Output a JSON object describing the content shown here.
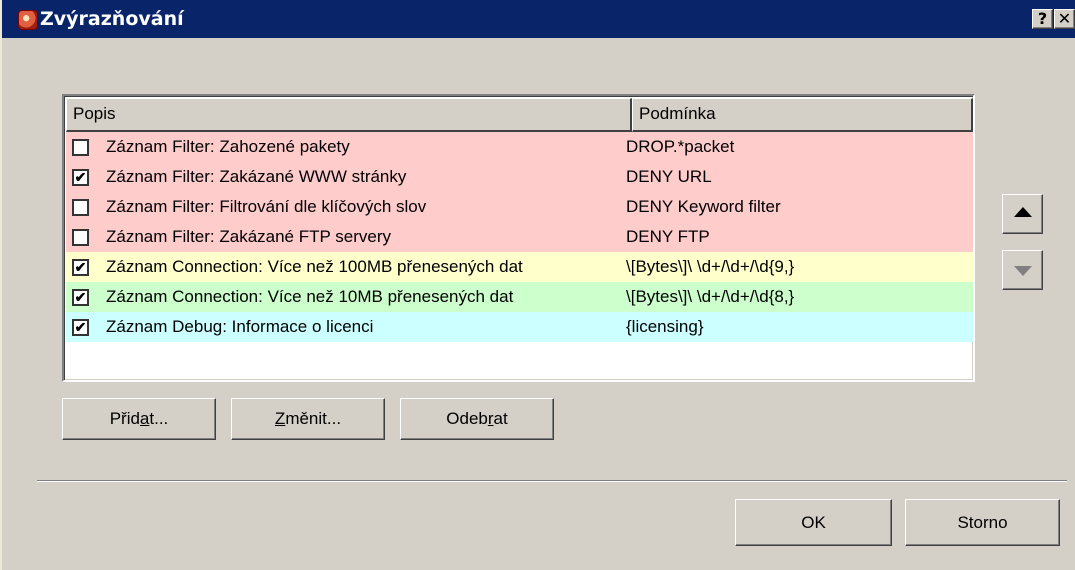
{
  "window": {
    "title": "Zvýrazňování",
    "help_label": "?",
    "close_label": "✕"
  },
  "list": {
    "columns": [
      "Popis",
      "Podmínka"
    ],
    "rows": [
      {
        "checked": "",
        "popis": "Záznam Filter: Zahozené pakety",
        "podminka": "DROP.*packet",
        "color": "#ffcccc"
      },
      {
        "checked": "✔",
        "popis": "Záznam Filter: Zakázané WWW stránky",
        "podminka": "DENY URL",
        "color": "#ffcccc"
      },
      {
        "checked": "",
        "popis": "Záznam Filter: Filtrování dle klíčových slov",
        "podminka": "DENY Keyword filter",
        "color": "#ffcccc"
      },
      {
        "checked": "",
        "popis": "Záznam Filter: Zakázané FTP servery",
        "podminka": "DENY FTP",
        "color": "#ffcccc"
      },
      {
        "checked": "✔",
        "popis": "Záznam Connection: Více než 100MB přenesených dat",
        "podminka": "\\[Bytes\\]\\ \\d+/\\d+/\\d{9,}",
        "color": "#ffffcc"
      },
      {
        "checked": "✔",
        "popis": "Záznam Connection: Více než 10MB přenesených dat",
        "podminka": "\\[Bytes\\]\\ \\d+/\\d+/\\d{8,}",
        "color": "#ccffcc"
      },
      {
        "checked": "✔",
        "popis": "Záznam Debug: Informace o licenci",
        "podminka": "{licensing}",
        "color": "#ccffff"
      }
    ]
  },
  "buttons": {
    "add": {
      "pre": "Přid",
      "u": "a",
      "post": "t..."
    },
    "edit": {
      "pre": "",
      "u": "Z",
      "post": "měnit..."
    },
    "remove": {
      "pre": "Odeb",
      "u": "r",
      "post": "at"
    },
    "ok": "OK",
    "cancel": "Storno"
  },
  "icons": {
    "up": "triangle-up-icon",
    "down": "triangle-down-icon"
  }
}
